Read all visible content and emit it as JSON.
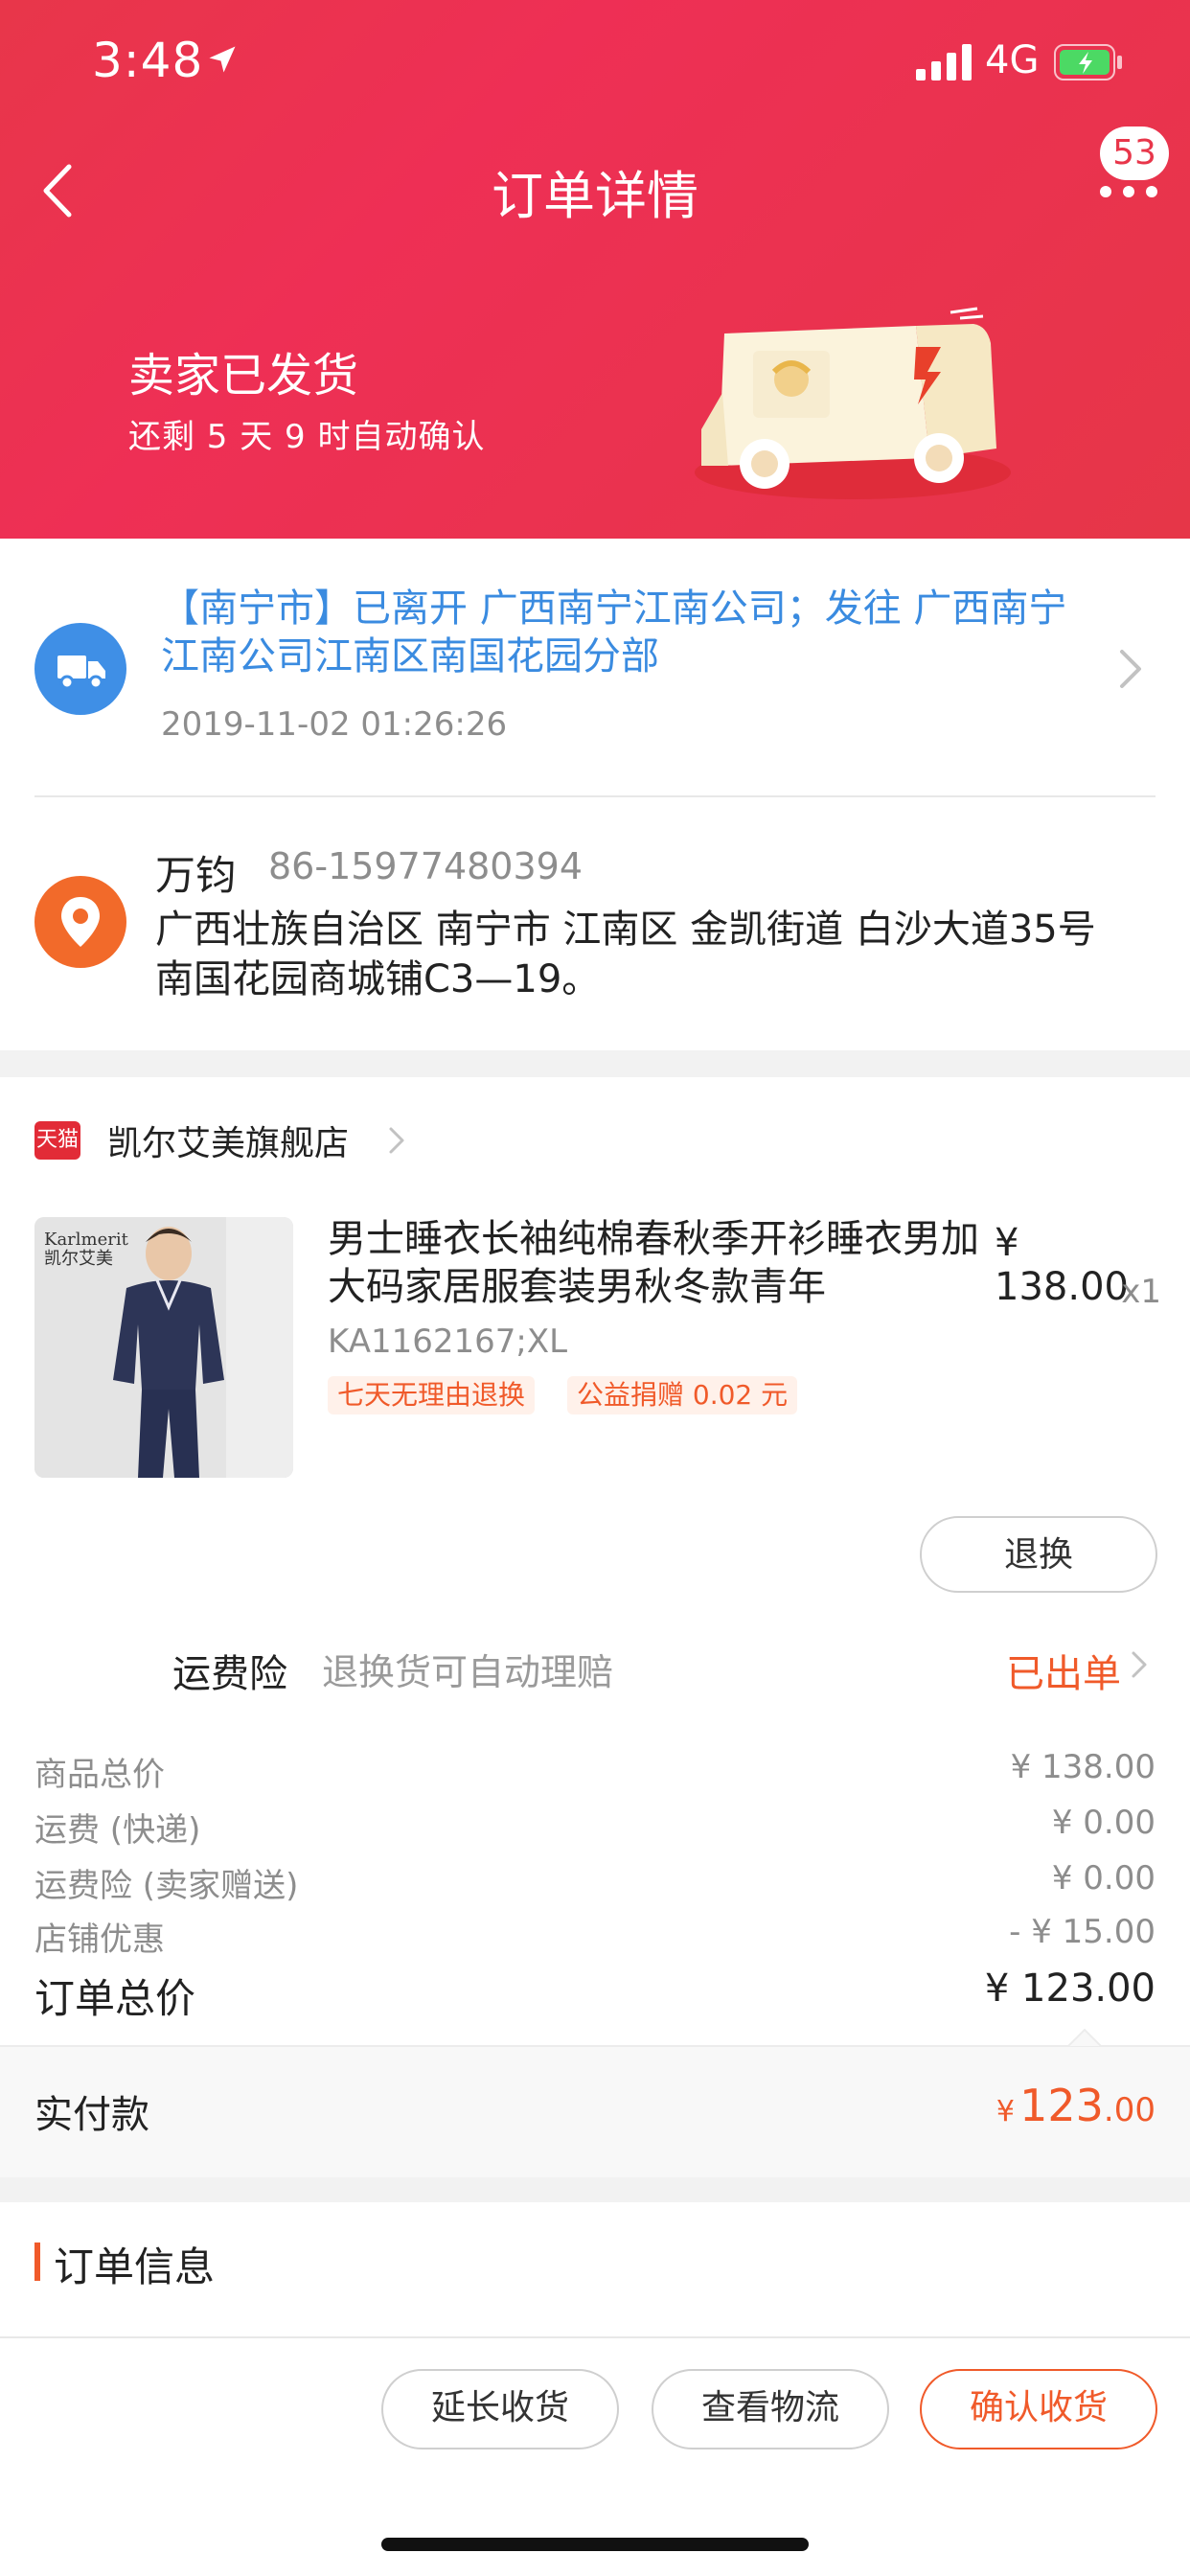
{
  "status_bar": {
    "time": "3:48",
    "network": "4G"
  },
  "nav": {
    "title": "订单详情",
    "badge_count": "53"
  },
  "status": {
    "title": "卖家已发货",
    "subtitle": "还剩 5 天 9 时自动确认"
  },
  "logistics": {
    "text": "【南宁市】已离开 广西南宁江南公司；发往 广西南宁江南公司江南区南国花园分部",
    "time": "2019-11-02 01:26:26"
  },
  "address": {
    "name": "万钧",
    "phone": "86-15977480394",
    "detail": "广西壮族自治区 南宁市 江南区 金凯街道 白沙大道35号南国花园商城铺C3—19。"
  },
  "shop": {
    "logo_text": "天猫",
    "name": "凯尔艾美旗舰店"
  },
  "product": {
    "brand_en": "Karlmerit",
    "brand_cn": "凯尔艾美",
    "title": "男士睡衣长袖纯棉春秋季开衫睡衣男加大码家居服套装男秋冬款青年",
    "price": "¥ 138.00",
    "qty": "x1",
    "sku": "KA1162167;XL",
    "tags": [
      "七天无理由退换",
      "公益捐赠 0.02 元"
    ],
    "refund_label": "退换"
  },
  "insurance": {
    "label": "运费险",
    "desc": "退换货可自动理赔",
    "status": "已出单"
  },
  "fees": [
    {
      "label": "商品总价",
      "value": "¥ 138.00"
    },
    {
      "label": "运费 (快递)",
      "value": "¥ 0.00"
    },
    {
      "label": "运费险 (卖家赠送)",
      "value": "¥ 0.00"
    },
    {
      "label": "店铺优惠",
      "value": "- ¥ 15.00"
    }
  ],
  "total": {
    "label": "订单总价",
    "value": "¥ 123.00"
  },
  "paid": {
    "label": "实付款",
    "currency": "¥",
    "integer": "123",
    "decimal": ".00"
  },
  "order_info": {
    "title": "订单信息"
  },
  "actions": {
    "extend": "延长收货",
    "logistics": "查看物流",
    "confirm": "确认收货"
  },
  "colors": {
    "header_red": "#e8364a",
    "accent_orange": "#f05a2a",
    "link_blue": "#3a8be0"
  }
}
